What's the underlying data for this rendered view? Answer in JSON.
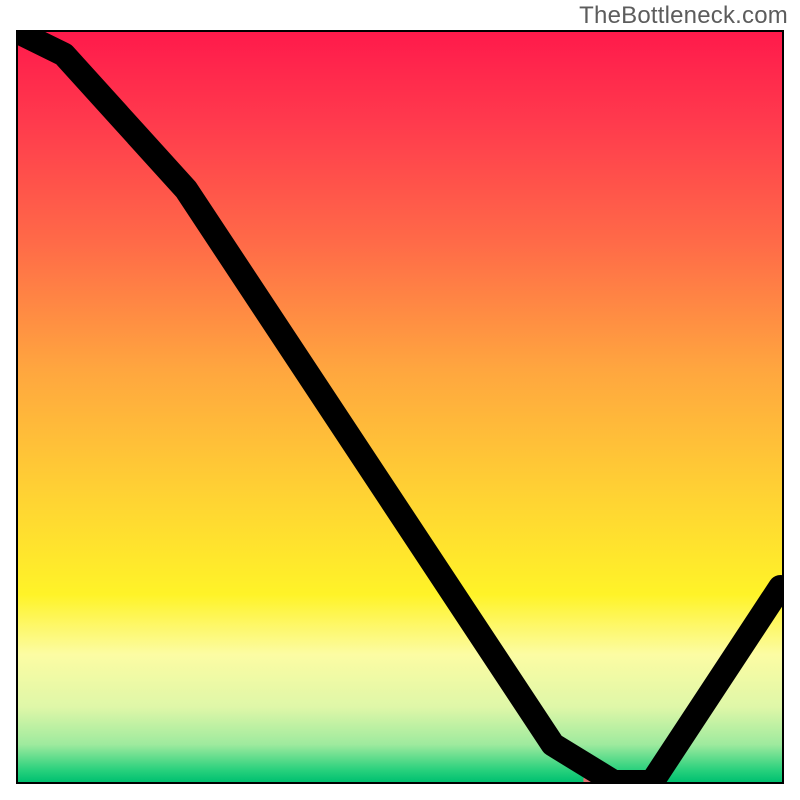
{
  "watermark": "TheBottleneck.com",
  "colors": {
    "gradient_stops": [
      {
        "offset": 0.0,
        "color": "#ff1a4b"
      },
      {
        "offset": 0.12,
        "color": "#ff3a4d"
      },
      {
        "offset": 0.28,
        "color": "#ff6a48"
      },
      {
        "offset": 0.45,
        "color": "#ffa63f"
      },
      {
        "offset": 0.62,
        "color": "#ffd333"
      },
      {
        "offset": 0.75,
        "color": "#fff328"
      },
      {
        "offset": 0.83,
        "color": "#fcfca3"
      },
      {
        "offset": 0.9,
        "color": "#dff7a8"
      },
      {
        "offset": 0.95,
        "color": "#9eea9e"
      },
      {
        "offset": 0.985,
        "color": "#26d07c"
      },
      {
        "offset": 1.0,
        "color": "#00c070"
      }
    ],
    "marker": "#e17171",
    "curve": "#000000",
    "border": "#000000",
    "watermark": "#5c5c5c"
  },
  "chart_data": {
    "type": "line",
    "title": "",
    "xlabel": "",
    "ylabel": "",
    "xlim": [
      0,
      100
    ],
    "ylim": [
      0,
      100
    ],
    "x": [
      0,
      6,
      22,
      70,
      78,
      83,
      99.8
    ],
    "values": [
      105,
      97,
      79,
      5,
      0,
      0,
      26
    ],
    "marker": {
      "x_start": 74,
      "x_end": 84,
      "y": 0.2
    },
    "notes": "Steep piecewise-linear descent with a slight knee near x≈22, touching zero on a short plateau around x≈78–83, then rising toward the right edge. Values are estimates read from the figure; no axis ticks are drawn."
  }
}
